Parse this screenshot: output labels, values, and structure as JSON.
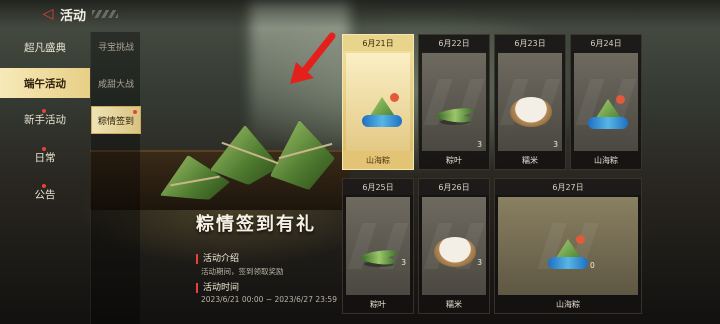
{
  "header": {
    "title": "活动"
  },
  "nav": {
    "items": [
      {
        "label": "超凡盛典",
        "active": false,
        "dot": false
      },
      {
        "label": "端午活动",
        "active": true,
        "dot": false
      },
      {
        "label": "新手活动",
        "active": false,
        "dot": true
      },
      {
        "label": "日常",
        "active": false,
        "dot": true
      },
      {
        "label": "公告",
        "active": false,
        "dot": true
      }
    ]
  },
  "subnav": {
    "items": [
      {
        "label": "寻宝挑战",
        "active": false
      },
      {
        "label": "咸甜大战",
        "active": false
      },
      {
        "label": "粽情签到",
        "active": true
      }
    ]
  },
  "event": {
    "title": "粽情签到有礼",
    "intro_heading": "活动介绍",
    "intro_text": "活动期间，签到领取奖励",
    "time_heading": "活动时间",
    "time_text": "2023/6/21 00:00 ~ 2023/6/27 23:59"
  },
  "rewards": [
    {
      "date": "6月21日",
      "item": "山海粽",
      "qty": "",
      "icon": "zongzi-icon",
      "today": true
    },
    {
      "date": "6月22日",
      "item": "粽叶",
      "qty": "3",
      "icon": "leaf-icon",
      "today": false
    },
    {
      "date": "6月23日",
      "item": "糯米",
      "qty": "3",
      "icon": "rice-icon",
      "today": false
    },
    {
      "date": "6月24日",
      "item": "山海粽",
      "qty": "",
      "icon": "zongzi-icon",
      "today": false
    },
    {
      "date": "6月25日",
      "item": "粽叶",
      "qty": "3",
      "icon": "leaf-icon",
      "today": false
    },
    {
      "date": "6月26日",
      "item": "糯米",
      "qty": "3",
      "icon": "rice-icon",
      "today": false
    },
    {
      "date": "6月27日",
      "item": "山海粽",
      "qty": "0",
      "icon": "zongzi-icon",
      "today": false
    }
  ],
  "colors": {
    "accent": "#e8413a",
    "gold": "#e8cf86",
    "arrow": "#e3201b"
  }
}
